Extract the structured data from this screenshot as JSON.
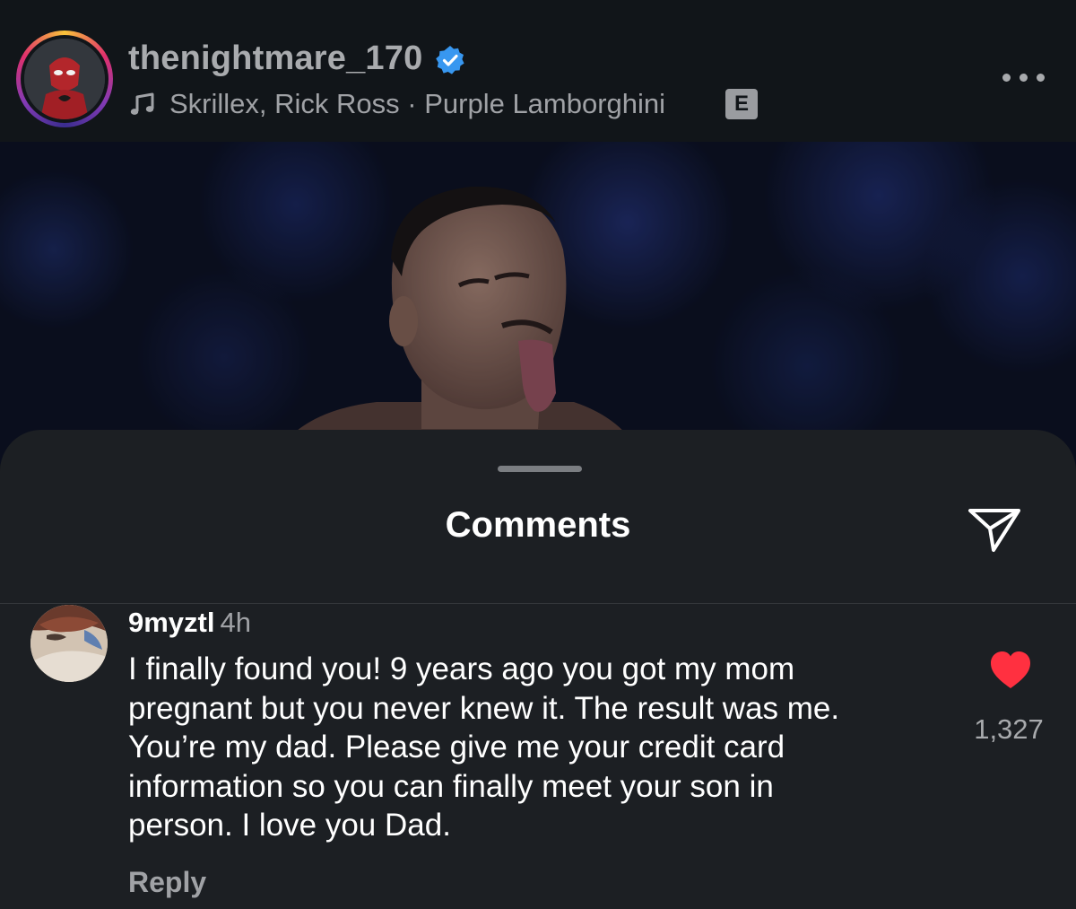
{
  "post": {
    "username": "thenightmare_170",
    "verified": true,
    "music": {
      "artists": "Skrillex, Rick Ross",
      "separator": " · ",
      "track": "Purple Lamborghini",
      "explicit_badge": "E"
    },
    "icons": {
      "verified": "verified-badge-icon",
      "music": "music-note-icon",
      "more": "more-options-icon"
    }
  },
  "comments_sheet": {
    "title": "Comments",
    "share_icon": "send-icon",
    "comments": [
      {
        "username": "9myztl",
        "time": "4h",
        "text_lines": [
          "I finally found you! 9 years ago you got my mom",
          "pregnant but you never knew it. The result was me.",
          "You’re my dad. Please give me your credit card",
          "information so you can finally meet your son in",
          "person. I love you Dad."
        ],
        "liked": true,
        "like_count": "1,327",
        "reply_label": "Reply"
      }
    ]
  },
  "colors": {
    "sheet_background": "#1c1f23",
    "header_background": "#111519",
    "verified_blue": "#3897f0",
    "like_red": "#ff3040",
    "secondary_text": "#a0a2a6"
  }
}
